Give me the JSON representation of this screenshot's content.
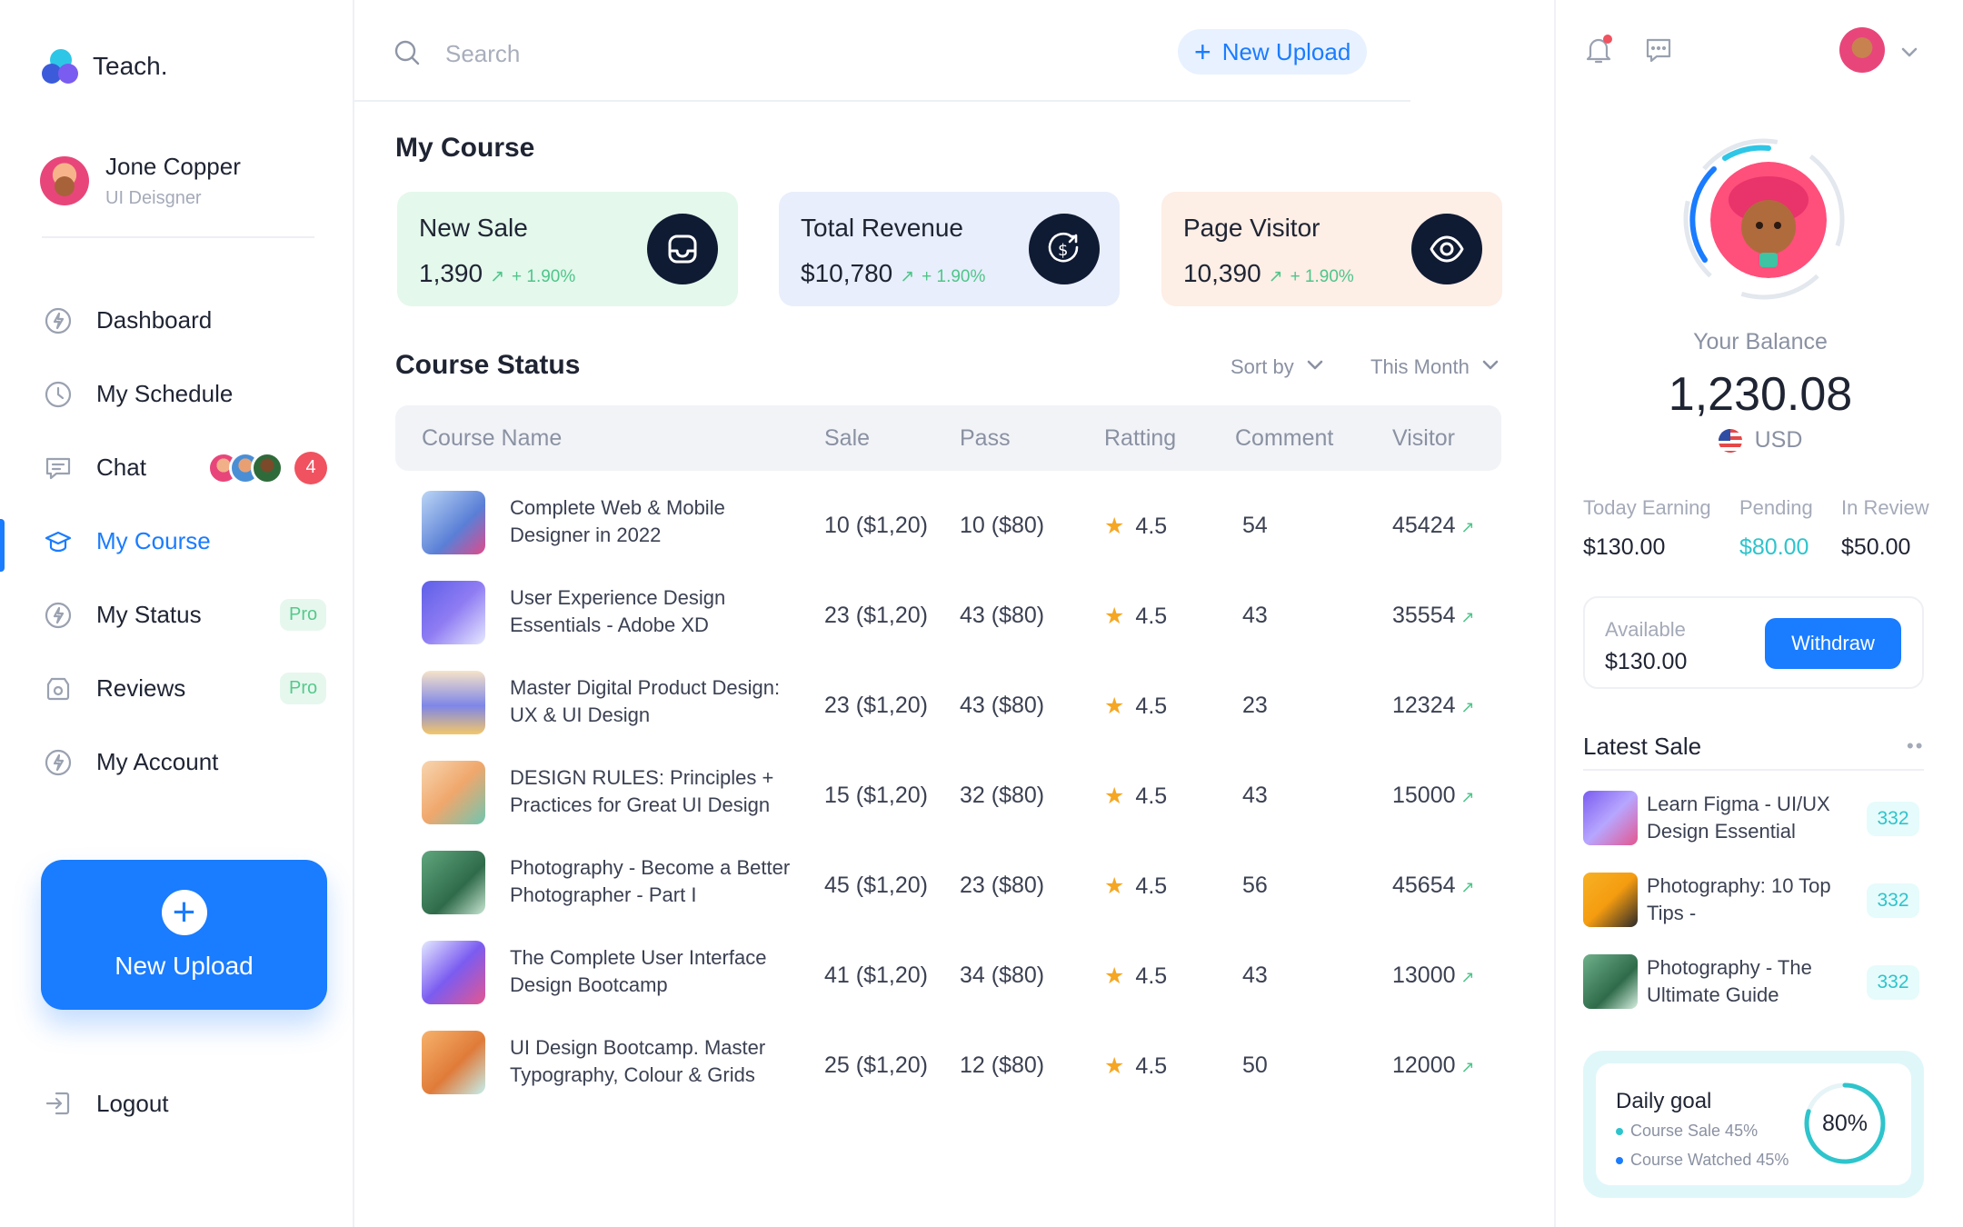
{
  "brand": {
    "name": "Teach."
  },
  "profile": {
    "name": "Jone Copper",
    "role": "UI Deisgner"
  },
  "nav": [
    {
      "label": "Dashboard",
      "icon": "dashboard-icon"
    },
    {
      "label": "My Schedule",
      "icon": "clock-icon"
    },
    {
      "label": "Chat",
      "icon": "chat-icon",
      "count": "4"
    },
    {
      "label": "My Course",
      "icon": "course-icon",
      "active": true
    },
    {
      "label": "My Status",
      "icon": "status-icon",
      "badge": "Pro"
    },
    {
      "label": "Reviews",
      "icon": "reviews-icon",
      "badge": "Pro"
    },
    {
      "label": "My Account",
      "icon": "account-icon"
    }
  ],
  "upload_card": {
    "label": "New Upload"
  },
  "logout": {
    "label": "Logout"
  },
  "topbar": {
    "search_placeholder": "Search",
    "upload_label": "New Upload"
  },
  "main": {
    "title": "My Course",
    "stats": [
      {
        "title": "New Sale",
        "value": "1,390",
        "trend": "+ 1.90%",
        "bg": "#e4f8ec",
        "icon": "inbox-icon"
      },
      {
        "title": "Total Revenue",
        "value": "$10,780",
        "trend": "+ 1.90%",
        "bg": "#e8eefb",
        "icon": "dollar-icon"
      },
      {
        "title": "Page Visitor",
        "value": "10,390",
        "trend": "+ 1.90%",
        "bg": "#fdeee6",
        "icon": "eye-icon"
      }
    ],
    "status_title": "Course Status",
    "sort_label": "Sort by",
    "period_label": "This Month",
    "columns": [
      "Course Name",
      "Sale",
      "Pass",
      "Ratting",
      "Comment",
      "Visitor"
    ],
    "rows": [
      {
        "name": "Complete Web & Mobile Designer in 2022",
        "sale": "10 ($1,20)",
        "pass": "10 ($80)",
        "rating": "4.5",
        "comment": "54",
        "visitor": "45424"
      },
      {
        "name": "User Experience Design Essentials - Adobe XD",
        "sale": "23 ($1,20)",
        "pass": "43 ($80)",
        "rating": "4.5",
        "comment": "43",
        "visitor": "35554"
      },
      {
        "name": "Master Digital Product Design: UX & UI Design",
        "sale": "23 ($1,20)",
        "pass": "43 ($80)",
        "rating": "4.5",
        "comment": "23",
        "visitor": "12324"
      },
      {
        "name": "DESIGN RULES: Principles + Practices for Great UI Design",
        "sale": "15 ($1,20)",
        "pass": "32 ($80)",
        "rating": "4.5",
        "comment": "43",
        "visitor": "15000"
      },
      {
        "name": "Photography - Become a Better Photographer - Part I",
        "sale": "45 ($1,20)",
        "pass": "23 ($80)",
        "rating": "4.5",
        "comment": "56",
        "visitor": "45654"
      },
      {
        "name": "The Complete User Interface Design Bootcamp",
        "sale": "41 ($1,20)",
        "pass": "34 ($80)",
        "rating": "4.5",
        "comment": "43",
        "visitor": "13000"
      },
      {
        "name": "UI Design Bootcamp. Master Typography, Colour & Grids",
        "sale": "25 ($1,20)",
        "pass": "12 ($80)",
        "rating": "4.5",
        "comment": "50",
        "visitor": "12000"
      }
    ]
  },
  "right": {
    "balance_label": "Your Balance",
    "balance": "1,230.08",
    "currency": "USD",
    "earnings": [
      {
        "label": "Today Earning",
        "value": "$130.00",
        "color": "#1f2433"
      },
      {
        "label": "Pending",
        "value": "$80.00",
        "color": "#2ec4cc"
      },
      {
        "label": "In Review",
        "value": "$50.00",
        "color": "#1f2433"
      }
    ],
    "available_label": "Available",
    "available_value": "$130.00",
    "withdraw_label": "Withdraw",
    "latest_sale_title": "Latest Sale",
    "latest_sales": [
      {
        "name": "Learn Figma - UI/UX Design Essential",
        "count": "332"
      },
      {
        "name": "Photography: 10 Top Tips -",
        "count": "332"
      },
      {
        "name": "Photography - The Ultimate Guide",
        "count": "332"
      }
    ],
    "goal": {
      "title": "Daily goal",
      "items": [
        {
          "label": "Course Sale 45%",
          "color": "#2ec4cc"
        },
        {
          "label": "Course Watched 45%",
          "color": "#1a7cff"
        }
      ],
      "percent_label": "80%",
      "progress": 0.8
    }
  },
  "colors": {
    "accent": "#1a7cff",
    "teal": "#2ec4cc",
    "trend": "#4fc58a",
    "alert": "#f0525f"
  }
}
